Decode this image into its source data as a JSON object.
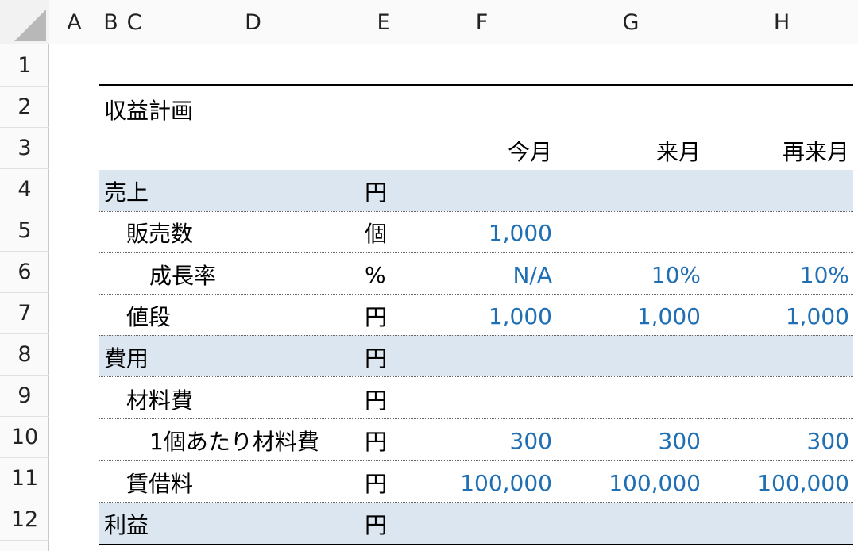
{
  "columns": [
    "A",
    "B",
    "C",
    "D",
    "E",
    "F",
    "G",
    "H"
  ],
  "rows": [
    "1",
    "2",
    "3",
    "4",
    "5",
    "6",
    "7",
    "8",
    "9",
    "10",
    "11",
    "12"
  ],
  "sheet": {
    "title": "収益計画",
    "periods": [
      "今月",
      "来月",
      "再来月"
    ],
    "lines": [
      {
        "label": "売上",
        "unit": "円",
        "values": [
          "",
          "",
          ""
        ]
      },
      {
        "label": "販売数",
        "unit": "個",
        "values": [
          "1,000",
          "",
          ""
        ]
      },
      {
        "label": "成長率",
        "unit": "%",
        "values": [
          "N/A",
          "10%",
          "10%"
        ]
      },
      {
        "label": "値段",
        "unit": "円",
        "values": [
          "1,000",
          "1,000",
          "1,000"
        ]
      },
      {
        "label": "費用",
        "unit": "円",
        "values": [
          "",
          "",
          ""
        ]
      },
      {
        "label": "材料費",
        "unit": "円",
        "values": [
          "",
          "",
          ""
        ]
      },
      {
        "label": "1個あたり材料費",
        "unit": "円",
        "values": [
          "300",
          "300",
          "300"
        ]
      },
      {
        "label": "賃借料",
        "unit": "円",
        "values": [
          "100,000",
          "100,000",
          "100,000"
        ]
      },
      {
        "label": "利益",
        "unit": "円",
        "values": [
          "",
          "",
          ""
        ]
      }
    ]
  },
  "colors": {
    "input_value": "#1f6fb4",
    "band": "#dce6f1"
  }
}
